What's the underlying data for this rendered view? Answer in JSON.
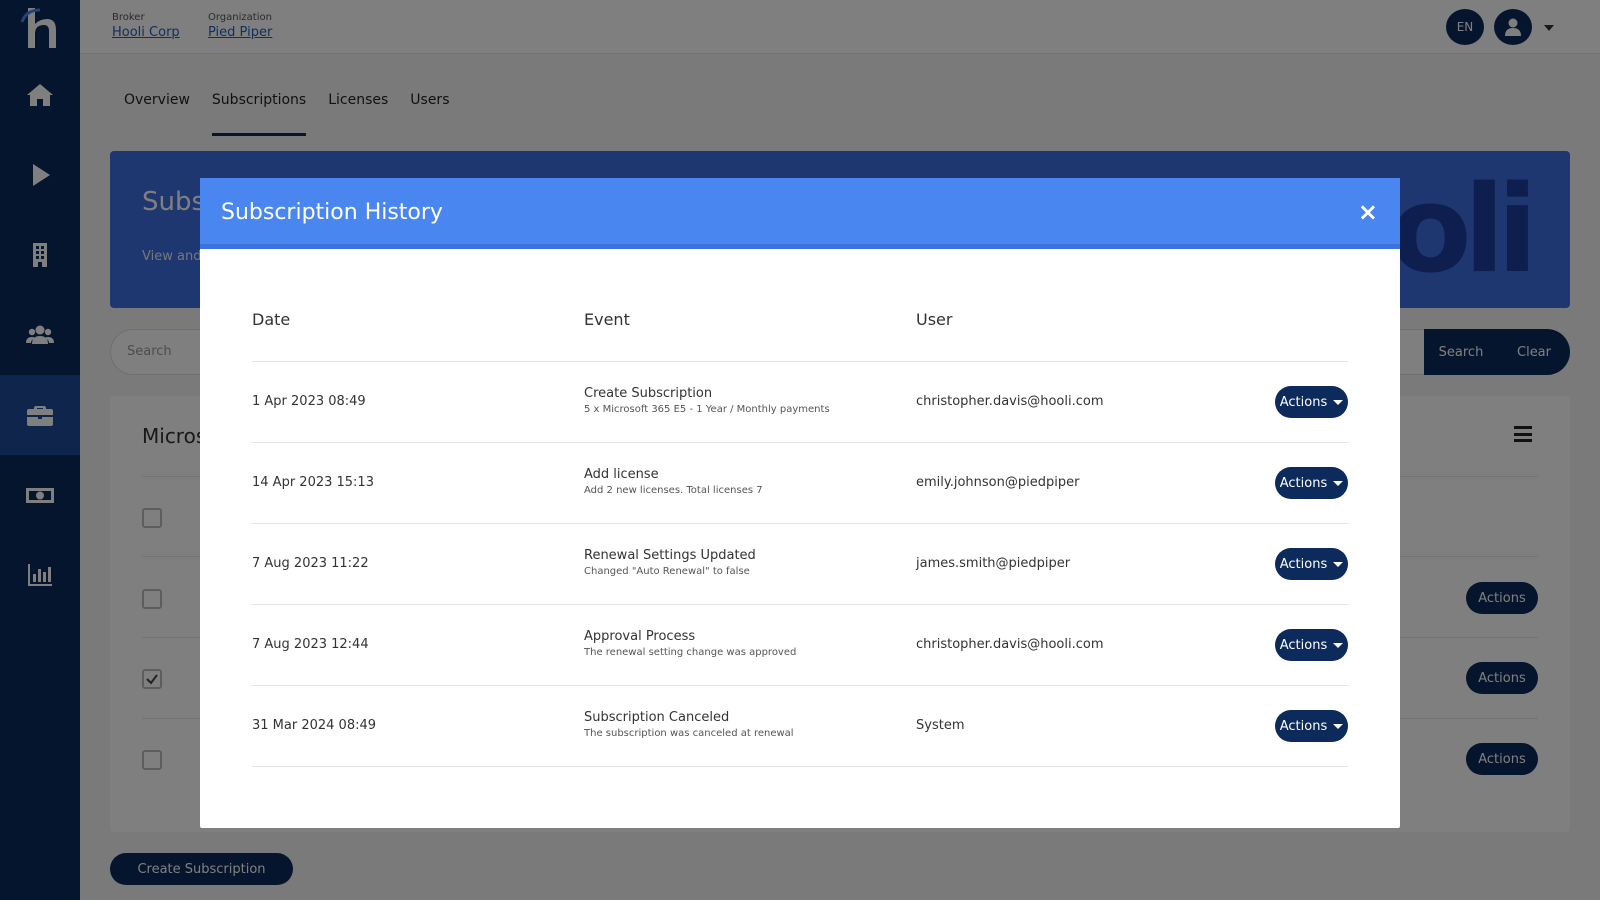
{
  "header": {
    "broker_label": "Broker",
    "broker_value": "Hooli Corp",
    "org_label": "Organization",
    "org_value": "Pied Piper",
    "lang": "EN"
  },
  "sidebar": {
    "items": [
      {
        "icon": "home-icon"
      },
      {
        "icon": "play-icon"
      },
      {
        "icon": "building-icon"
      },
      {
        "icon": "users-icon"
      },
      {
        "icon": "briefcase-icon",
        "active": true
      },
      {
        "icon": "money-icon"
      },
      {
        "icon": "chart-icon"
      }
    ]
  },
  "tabs": [
    "Overview",
    "Subscriptions",
    "Licenses",
    "Users"
  ],
  "banner": {
    "title": "Subsc",
    "subtitle": "View and",
    "brand": "ooli"
  },
  "search": {
    "placeholder": "Search",
    "search_label": "Search",
    "clear_label": "Clear"
  },
  "card": {
    "title": "Micros",
    "row_actions": "Actions"
  },
  "create_button": "Create Subscription",
  "modal": {
    "title": "Subscription History",
    "close": "×",
    "columns": {
      "date": "Date",
      "event": "Event",
      "user": "User"
    },
    "action_label": "Actions",
    "rows": [
      {
        "date": "1 Apr 2023 08:49",
        "event": "Create Subscription",
        "desc": "5 x Microsoft 365 E5 - 1 Year / Monthly payments",
        "user": "christopher.davis@hooli.com"
      },
      {
        "date": "14 Apr 2023 15:13",
        "event": "Add license",
        "desc": "Add 2 new licenses. Total licenses 7",
        "user": "emily.johnson@piedpiper"
      },
      {
        "date": "7 Aug 2023 11:22",
        "event": "Renewal Settings Updated",
        "desc": "Changed \"Auto Renewal\" to false",
        "user": "james.smith@piedpiper"
      },
      {
        "date": "7 Aug 2023 12:44",
        "event": "Approval Process",
        "desc": "The renewal setting change was approved",
        "user": "christopher.davis@hooli.com"
      },
      {
        "date": "31 Mar 2024 08:49",
        "event": "Subscription Canceled",
        "desc": "The subscription was canceled at renewal",
        "user": "System"
      }
    ]
  },
  "colors": {
    "sidebar": "#0d2a5c",
    "modal_header": "#4a86ef",
    "banner": "#3c6fe0",
    "button": "#0d2a5c"
  }
}
